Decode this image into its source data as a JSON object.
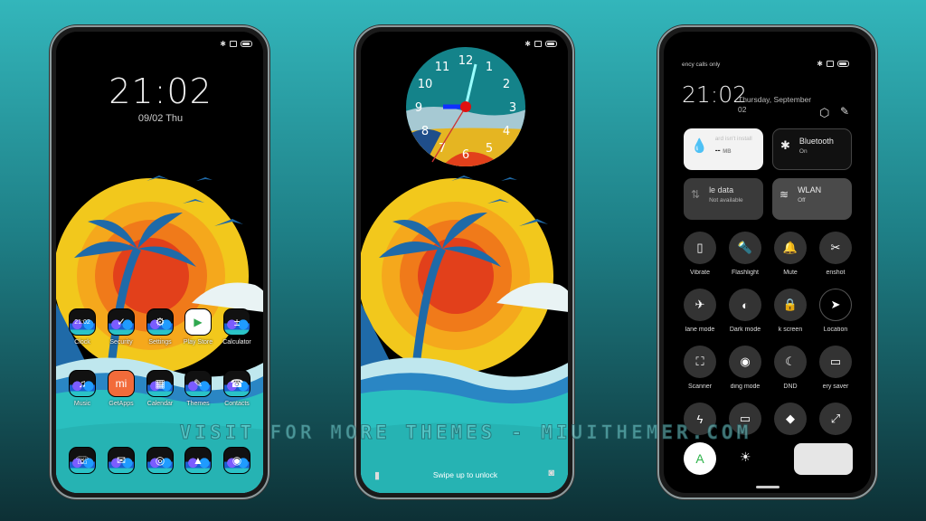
{
  "colors": {
    "background_top": "#33b6bb",
    "background_bottom": "#0d3035",
    "sun_yellow": "#f2c81c",
    "sun_orange": "#f07a1a",
    "sun_red": "#e2401b",
    "sea_teal": "#2abfbf",
    "palm_blue": "#1f6aa8"
  },
  "home": {
    "time": "21:02",
    "date": "09/02 Thu",
    "apps_row1": [
      {
        "label": "Clock",
        "icon": "clock-icon",
        "glyph": "21:02"
      },
      {
        "label": "Security",
        "icon": "shield-icon",
        "glyph": "✓"
      },
      {
        "label": "Settings",
        "icon": "gear-icon",
        "glyph": "⚙"
      },
      {
        "label": "Play Store",
        "icon": "play-store-icon",
        "glyph": "▶"
      },
      {
        "label": "Calculator",
        "icon": "calculator-icon",
        "glyph": "±"
      }
    ],
    "apps_row2": [
      {
        "label": "Music",
        "icon": "music-icon",
        "glyph": "♫"
      },
      {
        "label": "GetApps",
        "icon": "getapps-icon",
        "glyph": "mi"
      },
      {
        "label": "Calendar",
        "icon": "calendar-icon",
        "glyph": "▦"
      },
      {
        "label": "Themes",
        "icon": "themes-icon",
        "glyph": "✎"
      },
      {
        "label": "Contacts",
        "icon": "contacts-icon",
        "glyph": "☎"
      }
    ],
    "dock": [
      {
        "icon": "phone-icon",
        "glyph": "☏"
      },
      {
        "icon": "messages-icon",
        "glyph": "✉"
      },
      {
        "icon": "browser-icon",
        "glyph": "◎"
      },
      {
        "icon": "gallery-icon",
        "glyph": "▲"
      },
      {
        "icon": "camera-icon",
        "glyph": "◉"
      }
    ]
  },
  "lock": {
    "clock_numbers": [
      "12",
      "1",
      "2",
      "3",
      "4",
      "5",
      "6",
      "7",
      "8",
      "9",
      "10",
      "11"
    ],
    "clock_time": "21:02",
    "unlock_text": "Swipe up to unlock"
  },
  "control_center": {
    "status_text": "ency calls only",
    "time": "21:02",
    "date_line1": "Thursday, September",
    "date_line2": "02",
    "tiles": [
      {
        "title": "",
        "subtitle": "ard isn't install",
        "value": "--",
        "unit": "MB",
        "icon": "drop-icon"
      },
      {
        "title": "Bluetooth",
        "subtitle": "On",
        "icon": "bluetooth-icon"
      },
      {
        "title": "le data",
        "subtitle": "Not available",
        "icon": "mobile-data-icon"
      },
      {
        "title": "WLAN",
        "subtitle": "Off",
        "icon": "wifi-icon"
      }
    ],
    "toggles": [
      {
        "label": "Vibrate",
        "glyph": "▯"
      },
      {
        "label": "Flashlight",
        "glyph": "🔦"
      },
      {
        "label": "Mute",
        "glyph": "🔔"
      },
      {
        "label": "enshot",
        "glyph": "✂"
      },
      {
        "label": "lane mode",
        "glyph": "✈"
      },
      {
        "label": "Dark mode",
        "glyph": "◐"
      },
      {
        "label": "k screen",
        "glyph": "🔒"
      },
      {
        "label": "Location",
        "glyph": "➤"
      },
      {
        "label": "Scanner",
        "glyph": "⛶"
      },
      {
        "label": "ding mode",
        "glyph": "◉"
      },
      {
        "label": "DND",
        "glyph": "☾"
      },
      {
        "label": "ery saver",
        "glyph": "▭"
      },
      {
        "label": "",
        "glyph": "ϟ"
      },
      {
        "label": "",
        "glyph": "▭"
      },
      {
        "label": "",
        "glyph": "◆"
      },
      {
        "label": "",
        "glyph": "⤢"
      }
    ],
    "auto_brightness_label": "A"
  },
  "watermark": "VISIT FOR MORE THEMES - MIUITHEMER.COM"
}
